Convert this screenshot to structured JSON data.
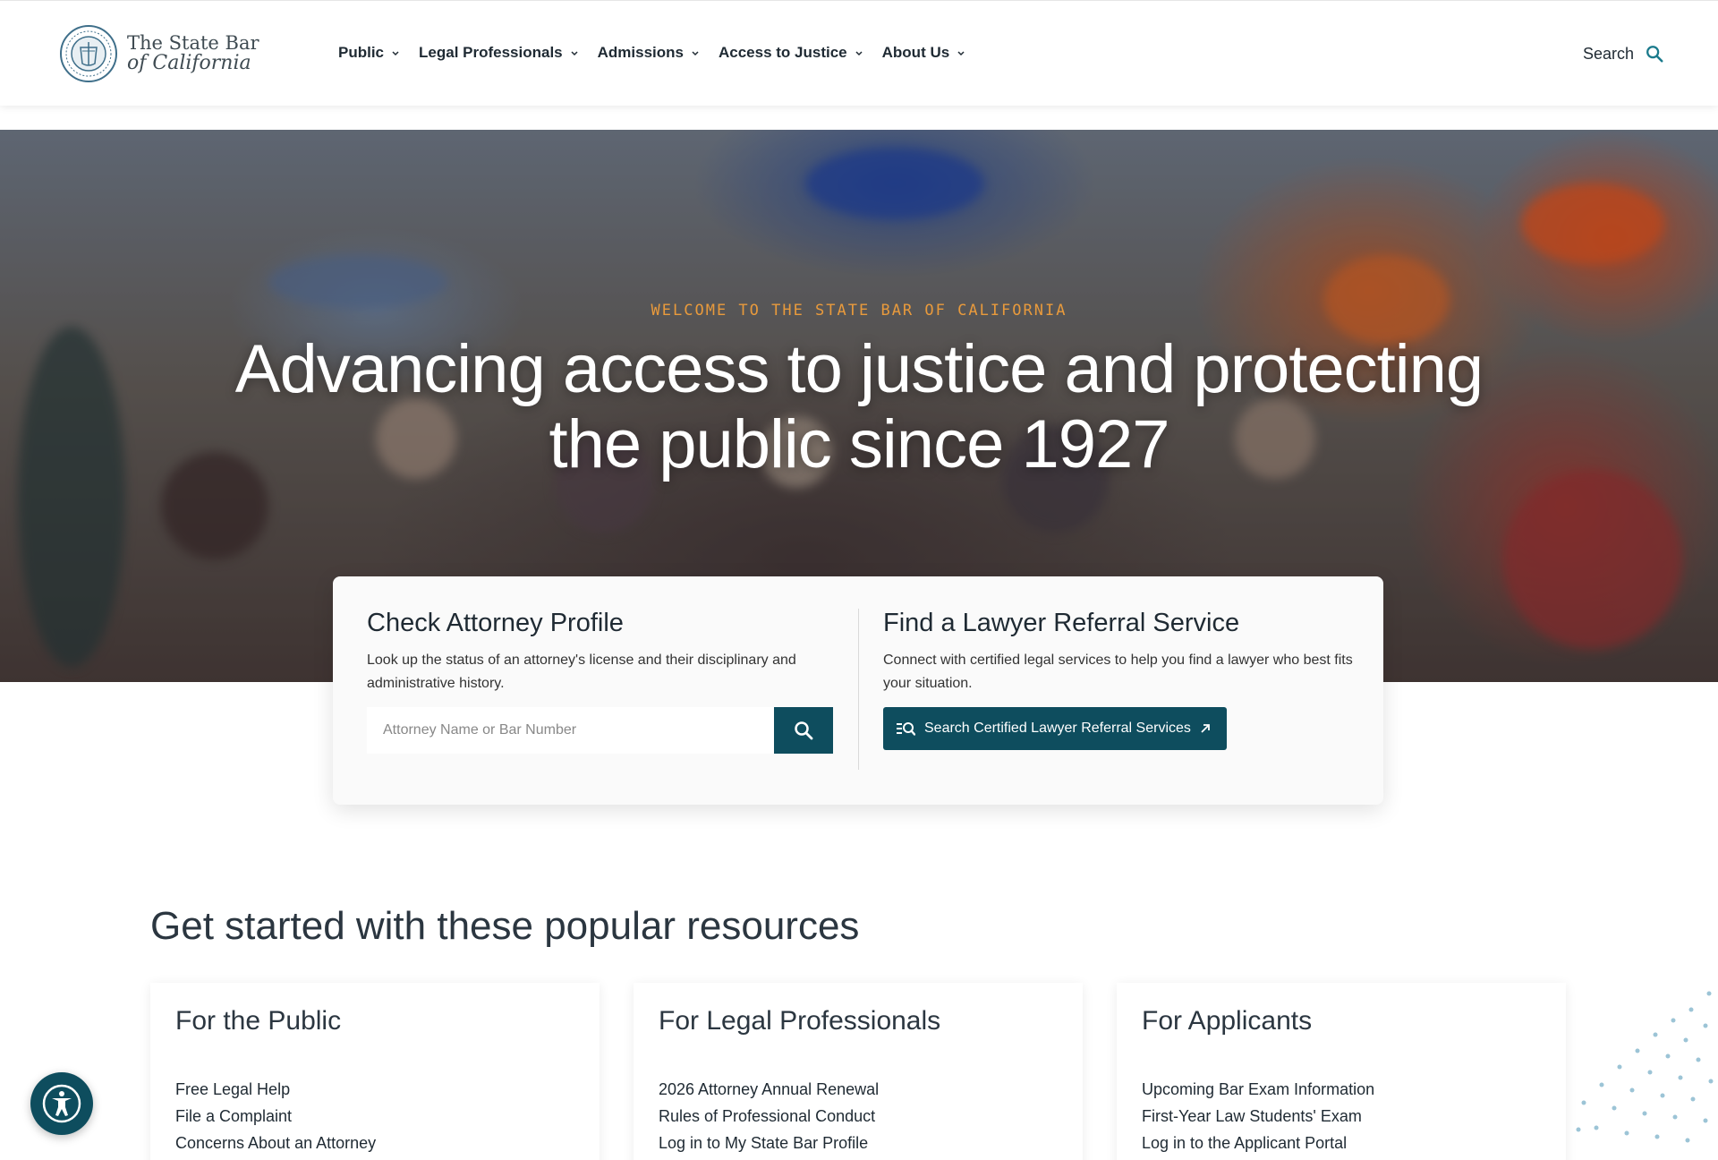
{
  "header": {
    "logo_line1": "The State Bar",
    "logo_line2": "of California",
    "nav": [
      {
        "label": "Public"
      },
      {
        "label": "Legal Professionals"
      },
      {
        "label": "Admissions"
      },
      {
        "label": "Access to Justice"
      },
      {
        "label": "About Us"
      }
    ],
    "search_label": "Search"
  },
  "hero": {
    "eyebrow": "WELCOME TO THE STATE BAR OF CALIFORNIA",
    "title": "Advancing access to justice and protecting the public since 1927"
  },
  "attorney_profile": {
    "heading": "Check Attorney Profile",
    "description": "Look up the status of an attorney's license and their disciplinary and administrative history.",
    "input_placeholder": "Attorney Name or Bar Number",
    "input_value": ""
  },
  "referral": {
    "heading": "Find a Lawyer Referral Service",
    "description": "Connect with certified legal services to help you find a lawyer who best fits your situation.",
    "button_label": "Search Certified Lawyer Referral Services"
  },
  "resources": {
    "title": "Get started with these popular resources",
    "cards": [
      {
        "heading": "For the Public",
        "links": [
          "Free Legal Help",
          "File a Complaint",
          "Concerns About an Attorney"
        ]
      },
      {
        "heading": "For Legal Professionals",
        "links": [
          "2026 Attorney Annual Renewal",
          "Rules of Professional Conduct",
          "Log in to My State Bar Profile"
        ]
      },
      {
        "heading": "For Applicants",
        "links": [
          "Upcoming Bar Exam Information",
          "First-Year Law Students' Exam",
          "Log in to the Applicant Portal"
        ]
      }
    ]
  },
  "colors": {
    "brand_teal": "#0e4d5e",
    "eyebrow_orange": "#e89a3c",
    "search_icon_teal": "#1a7a8c"
  },
  "icons": [
    "seal-logo",
    "chevron-down-icon",
    "search-icon",
    "list-search-icon",
    "external-arrow-icon",
    "accessibility-icon"
  ]
}
